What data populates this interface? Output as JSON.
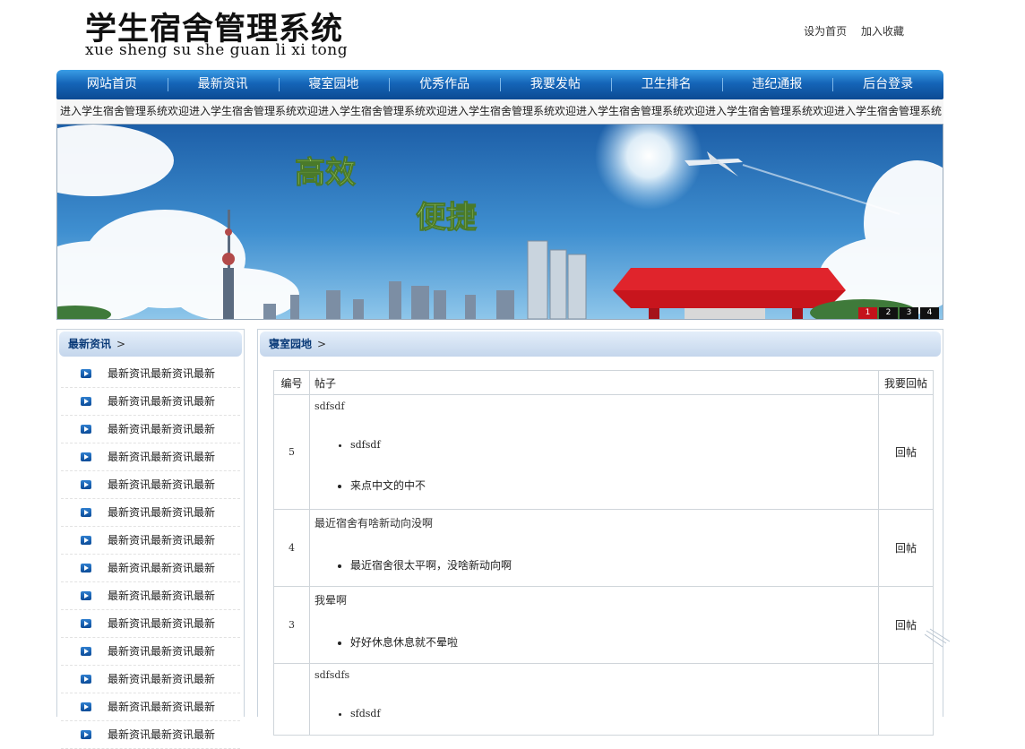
{
  "header": {
    "title": "学生宿舍管理系统",
    "pinyin": "xue sheng su she guan li xi tong",
    "links": [
      "设为首页",
      "加入收藏"
    ]
  },
  "nav": [
    "网站首页",
    "最新资讯",
    "寝室园地",
    "优秀作品",
    "我要发帖",
    "卫生排名",
    "违纪通报",
    "后台登录"
  ],
  "marquee": "进入学生宿舍管理系统欢迎进入学生宿舍管理系统欢迎进入学生宿舍管理系统欢迎进入学生宿舍管理系统欢迎进入学生宿舍管理系统欢迎进入学生宿舍管理系统欢迎进入学生宿舍管理系统",
  "banner": {
    "text1": "高效",
    "text2": "便捷",
    "pages": [
      "1",
      "2",
      "3",
      "4"
    ],
    "active_page": "1"
  },
  "sidebar": {
    "title": "最新资讯",
    "arrow": ">",
    "items": [
      "最新资讯最新资讯最新",
      "最新资讯最新资讯最新",
      "最新资讯最新资讯最新",
      "最新资讯最新资讯最新",
      "最新资讯最新资讯最新",
      "最新资讯最新资讯最新",
      "最新资讯最新资讯最新",
      "最新资讯最新资讯最新",
      "最新资讯最新资讯最新",
      "最新资讯最新资讯最新",
      "最新资讯最新资讯最新",
      "最新资讯最新资讯最新",
      "最新资讯最新资讯最新",
      "最新资讯最新资讯最新"
    ]
  },
  "main": {
    "title": "寝室园地",
    "arrow": ">",
    "headers": {
      "num": "编号",
      "post": "帖子",
      "reply": "我要回帖"
    },
    "reply_label": "回帖",
    "posts": [
      {
        "num": "5",
        "title": "sdfsdf",
        "replies": [
          "sdfsdf",
          "来点中文的中不"
        ]
      },
      {
        "num": "4",
        "title": "最近宿舍有啥新动向没啊",
        "replies": [
          "最近宿舍很太平啊，没啥新动向啊"
        ]
      },
      {
        "num": "3",
        "title": "我晕啊",
        "replies": [
          "好好休息休息就不晕啦"
        ]
      },
      {
        "num": "",
        "title": "sdfsdfs",
        "replies": [
          "sfdsdf"
        ]
      }
    ]
  }
}
